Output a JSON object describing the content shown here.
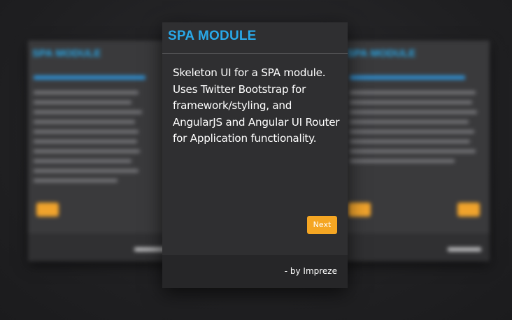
{
  "module_card": {
    "title": "SPA MODULE",
    "description": "Skeleton UI for a SPA module. Uses Twitter Bootstrap for framework/styling, and AngularJS and Angular UI Router for Application functionality.",
    "next_label": "Next",
    "footer_credit": "- by Impreze"
  },
  "colors": {
    "title_accent": "#29a8e8",
    "button": "#f5a623",
    "card_background": "#2f2f31",
    "footer_background": "#262628",
    "page_background": "#242426"
  }
}
